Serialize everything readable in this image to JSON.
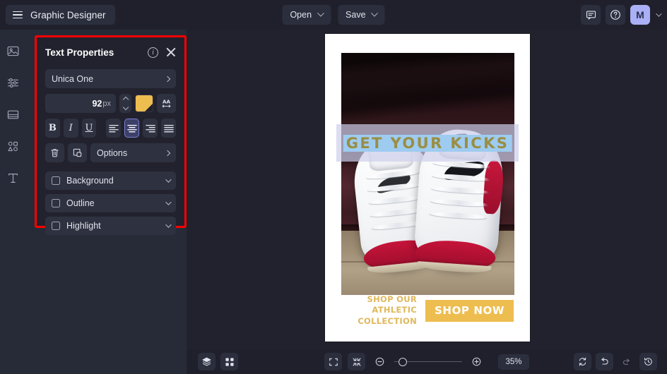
{
  "app": {
    "title": "Graphic Designer",
    "accent_purple": "#aab0f5",
    "highlight_red": "#ff0000",
    "gold": "#eebd50"
  },
  "topbar": {
    "menu_icon": "hamburger-icon",
    "open_label": "Open",
    "save_label": "Save",
    "comment_icon": "comment-icon",
    "help_icon": "help-circle-icon",
    "avatar_initial": "M"
  },
  "rail": {
    "items": [
      {
        "icon": "image-icon",
        "name": "images"
      },
      {
        "icon": "sliders-icon",
        "name": "adjustments"
      },
      {
        "icon": "layout-icon",
        "name": "layouts"
      },
      {
        "icon": "shapes-icon",
        "name": "elements"
      },
      {
        "icon": "text-icon",
        "name": "text"
      }
    ]
  },
  "panel": {
    "title": "Text Properties",
    "info_icon": "info-circle-icon",
    "close_icon": "close-icon",
    "font_name": "Unica One",
    "font_size_value": "92",
    "font_size_unit": "px",
    "color_swatch": "#eebd50",
    "letter_spacing_icon": "letter-spacing-icon",
    "bold_label": "B",
    "italic_label": "I",
    "underline_label": "U",
    "align_options": [
      "align-left",
      "align-center",
      "align-right",
      "align-justify"
    ],
    "align_selected": "align-center",
    "delete_icon": "trash-icon",
    "duplicate_icon": "duplicate-icon",
    "options_label": "Options",
    "accordions": [
      {
        "label": "Background",
        "checked": false
      },
      {
        "label": "Outline",
        "checked": false
      },
      {
        "label": "Highlight",
        "checked": false
      }
    ]
  },
  "canvas": {
    "headline_text": "GET YOUR KICKS",
    "headline_color": "#9a8e43",
    "selection_color": "#9ecbf0",
    "textbox_fill": "#cdceeb",
    "footer_line1": "SHOP OUR ATHLETIC",
    "footer_line2": "COLLECTION",
    "cta_label": "SHOP NOW",
    "cta_color": "#eebd50"
  },
  "bottombar": {
    "layers_icon": "layers-icon",
    "grid_icon": "grid-icon",
    "fullscreen_icon": "fullscreen-icon",
    "fit_icon": "fit-to-screen-icon",
    "zoom_out_icon": "zoom-out-icon",
    "zoom_in_icon": "zoom-in-icon",
    "zoom_level": "35%",
    "sync_icon": "sync-icon",
    "undo_icon": "undo-icon",
    "redo_icon": "redo-icon",
    "history_icon": "history-icon"
  }
}
